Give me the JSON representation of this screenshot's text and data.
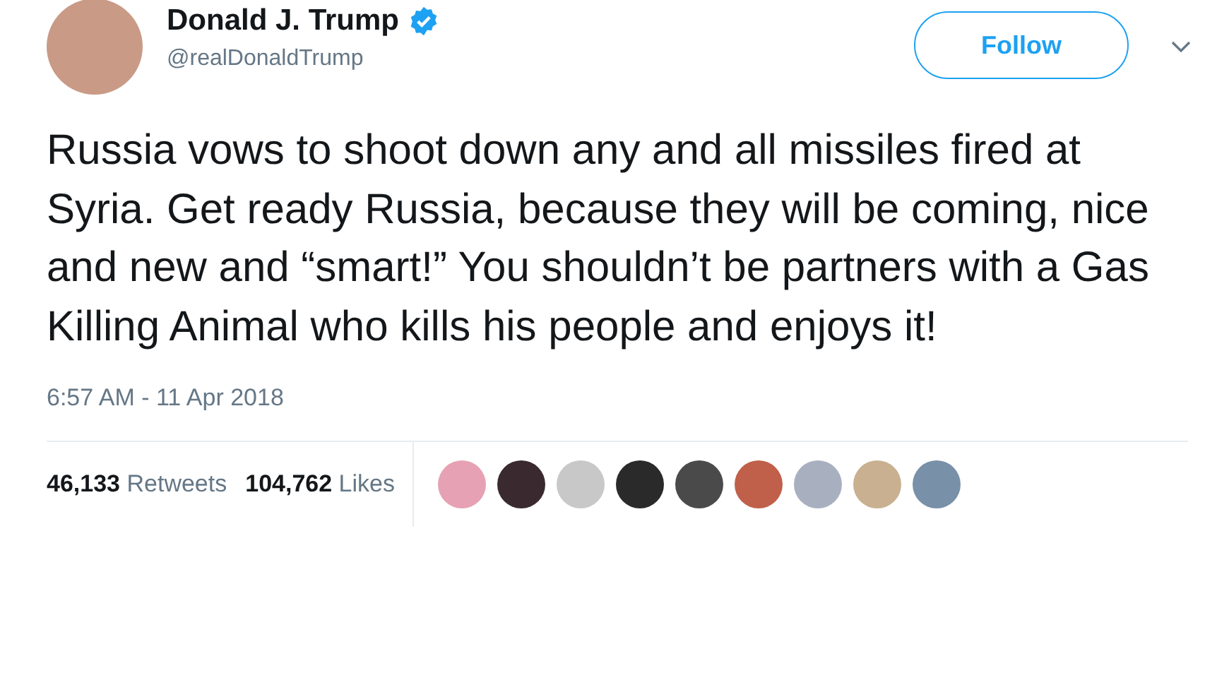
{
  "author": {
    "name": "Donald J. Trump",
    "verified": true,
    "handle": "@realDonaldTrump"
  },
  "follow_button": {
    "label": "Follow"
  },
  "tweet_text": "Russia vows to shoot down any and all missiles fired at Syria. Get ready Russia, because they will be coming, nice and new and “smart!” You shouldn’t be partners with a Gas Killing Animal who kills his people and enjoys it!",
  "timestamp": "6:57 AM - 11 Apr 2018",
  "stats": [
    {
      "count": "46,133",
      "label": "Retweets"
    },
    {
      "count": "104,762",
      "label": "Likes"
    }
  ],
  "liker_avatars": [
    {
      "color": "#e6a2b4"
    },
    {
      "color": "#3a2a30"
    },
    {
      "color": "#c8c8c8"
    },
    {
      "color": "#2a2a2a"
    },
    {
      "color": "#4a4a4a"
    },
    {
      "color": "#c0604a"
    },
    {
      "color": "#a8b0c0"
    },
    {
      "color": "#c8b090"
    },
    {
      "color": "#7890a8"
    }
  ]
}
